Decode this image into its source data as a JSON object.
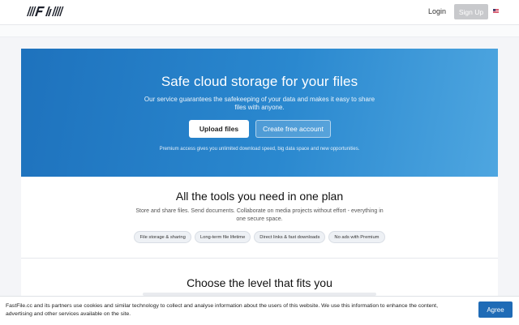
{
  "header": {
    "login_label": "Login",
    "signup_label": "Sign Up"
  },
  "hero": {
    "title": "Safe cloud storage for your files",
    "lead": "Our service guarantees the safekeeping of your data and makes it easy to share files with anyone.",
    "upload_label": "Upload files",
    "create_label": "Create free account",
    "note": "Premium access gives you unlimited download speed, big data space and new opportunities."
  },
  "tools": {
    "title": "All the tools you need in one plan",
    "description": "Store and share files. Send documents. Collaborate on media projects without effort - everything in one secure space.",
    "features": [
      "File storage & sharing",
      "Long-term file lifetime",
      "Direct links & fast downloads",
      "No ads with Premium"
    ]
  },
  "levels": {
    "title": "Choose the level that fits you"
  },
  "cookie": {
    "text": "FastFile.cc and its partners use cookies and similar technology to collect and analyse information about the users of this website. We use this information to enhance the content, advertising and other services available on the site.",
    "agree_label": "Agree"
  },
  "colors": {
    "accent": "#1f6bb6",
    "hero_start": "#1e72bd",
    "hero_end": "#4ea6e0"
  }
}
